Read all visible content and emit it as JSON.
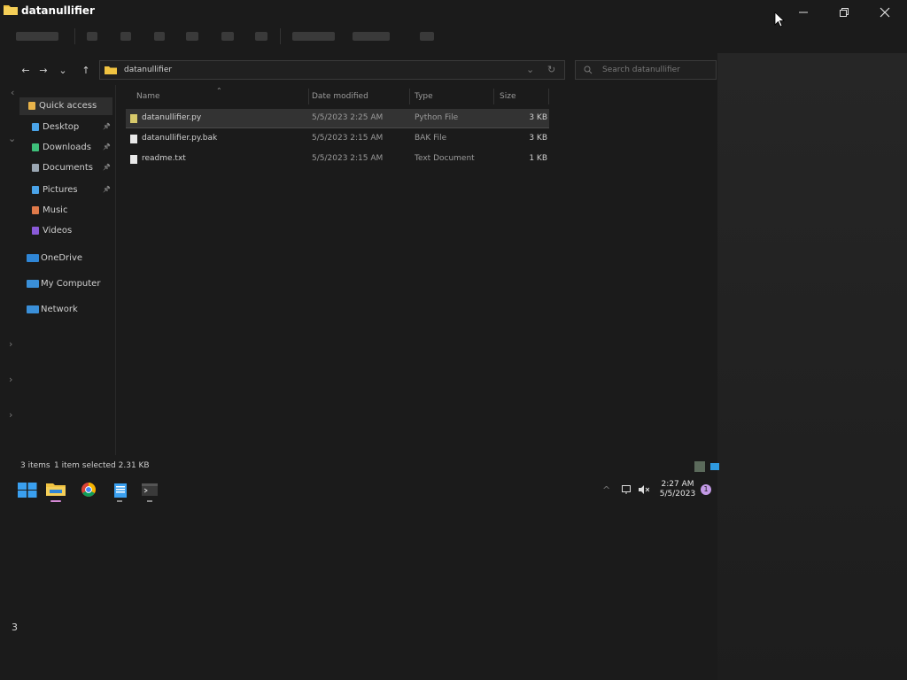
{
  "window": {
    "title": "datanullifier",
    "minimize_icon": "minimize-icon",
    "maximize_icon": "restore-icon",
    "close_icon": "close-icon"
  },
  "address_bar": {
    "path": "datanullifier",
    "search_placeholder": "Search datanullifier"
  },
  "sidebar": {
    "items": [
      {
        "label": "Quick access",
        "icon": "star-icon",
        "color": "#e8b34a",
        "pinned": false
      },
      {
        "label": "Desktop",
        "icon": "desktop-icon",
        "color": "#4aa3e8",
        "pinned": true
      },
      {
        "label": "Downloads",
        "icon": "download-icon",
        "color": "#3ec07a",
        "pinned": true
      },
      {
        "label": "Documents",
        "icon": "documents-icon",
        "color": "#9aa6b2",
        "pinned": true
      },
      {
        "label": "Pictures",
        "icon": "pictures-icon",
        "color": "#4aa3e8",
        "pinned": true
      },
      {
        "label": "Music",
        "icon": "music-icon",
        "color": "#e07a4a",
        "pinned": false
      },
      {
        "label": "Videos",
        "icon": "videos-icon",
        "color": "#8a5ad8",
        "pinned": false
      },
      {
        "label": "OneDrive",
        "icon": "cloud-icon",
        "color": "#2f86d6",
        "pinned": false
      },
      {
        "label": "My Computer",
        "icon": "computer-icon",
        "color": "#3a8fd8",
        "pinned": false
      },
      {
        "label": "Network",
        "icon": "network-icon",
        "color": "#3a8fd8",
        "pinned": false
      }
    ]
  },
  "columns": {
    "name": "Name",
    "date": "Date modified",
    "type": "Type",
    "size": "Size"
  },
  "files": [
    {
      "name": "datanullifier.py",
      "date": "5/5/2023 2:25 AM",
      "type": "Python File",
      "size": "3 KB",
      "selected": true
    },
    {
      "name": "datanullifier.py.bak",
      "date": "5/5/2023 2:15 AM",
      "type": "BAK File",
      "size": "3 KB",
      "selected": false
    },
    {
      "name": "readme.txt",
      "date": "5/5/2023 2:15 AM",
      "type": "Text Document",
      "size": "1 KB",
      "selected": false
    }
  ],
  "status": {
    "count": "3 items",
    "selected": "1 item selected  2.31 KB"
  },
  "taskbar": {
    "clock_time": "2:27 AM",
    "clock_date": "5/5/2023",
    "notification_count": "1"
  },
  "stray_text": "3",
  "colors": {
    "background": "#1b1b1b",
    "selection": "#333333",
    "folder": "#f0c341",
    "accent": "#4aa3e8"
  }
}
